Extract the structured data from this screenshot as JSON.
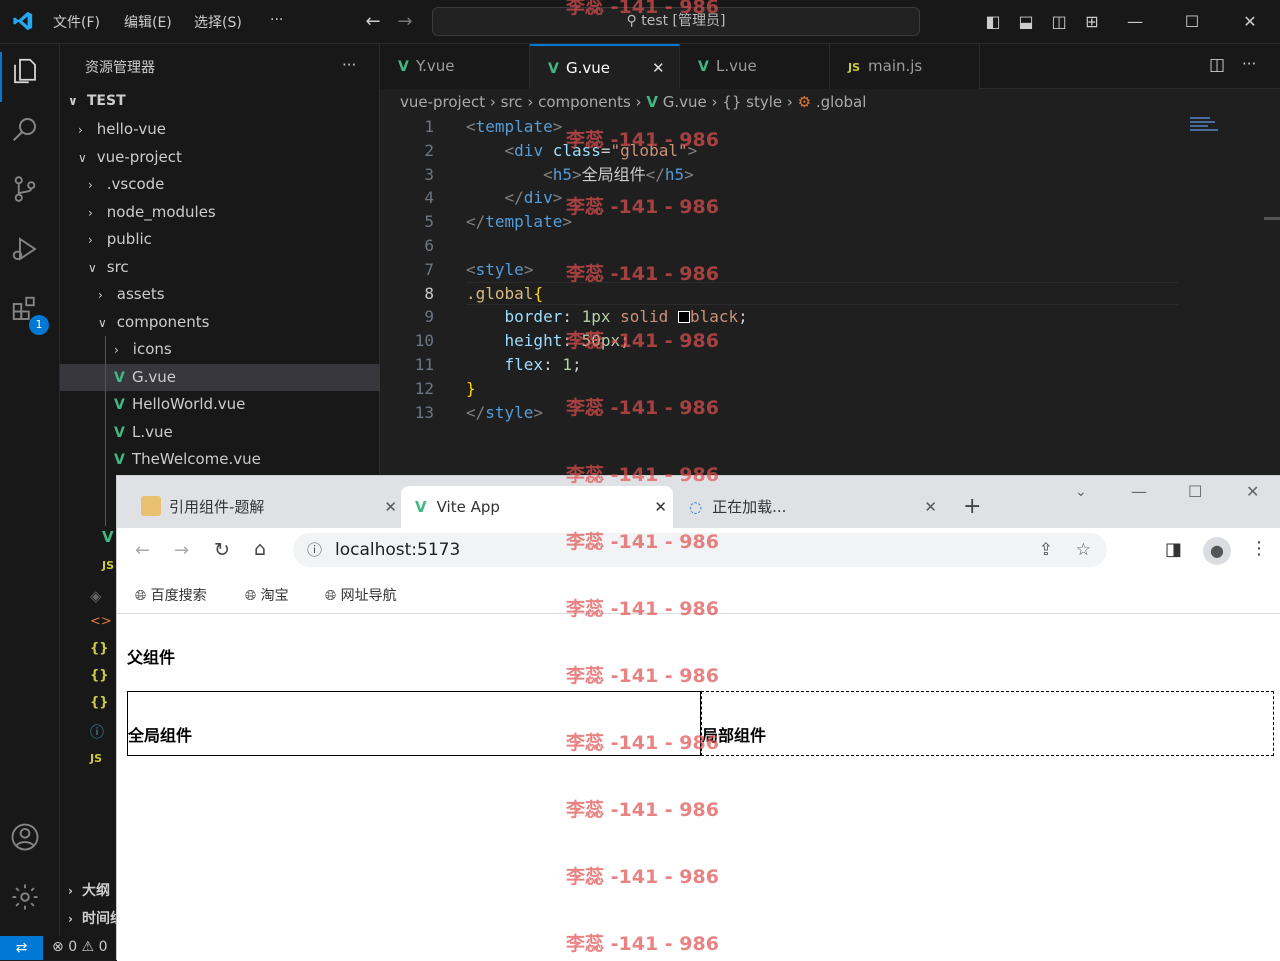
{
  "titlebar": {
    "menus": [
      "文件(F)",
      "编辑(E)",
      "选择(S)",
      "···"
    ],
    "command_center": "test [管理员]"
  },
  "activity_badge": "1",
  "sidebar": {
    "title": "资源管理器",
    "more": "···",
    "root": "TEST",
    "items": [
      {
        "label": "hello-vue",
        "depth": 1,
        "type": "folder-closed"
      },
      {
        "label": "vue-project",
        "depth": 1,
        "type": "folder-open"
      },
      {
        "label": ".vscode",
        "depth": 2,
        "type": "folder-closed"
      },
      {
        "label": "node_modules",
        "depth": 2,
        "type": "folder-closed"
      },
      {
        "label": "public",
        "depth": 2,
        "type": "folder-closed"
      },
      {
        "label": "src",
        "depth": 2,
        "type": "folder-open"
      },
      {
        "label": "assets",
        "depth": 3,
        "type": "folder-closed"
      },
      {
        "label": "components",
        "depth": 3,
        "type": "folder-open"
      },
      {
        "label": "icons",
        "depth": 4,
        "type": "folder-closed"
      },
      {
        "label": "G.vue",
        "depth": 4,
        "type": "vue",
        "selected": true
      },
      {
        "label": "HelloWorld.vue",
        "depth": 4,
        "type": "vue"
      },
      {
        "label": "L.vue",
        "depth": 4,
        "type": "vue"
      },
      {
        "label": "TheWelcome.vue",
        "depth": 4,
        "type": "vue"
      }
    ],
    "outline": "大纲",
    "timeline": "时间线"
  },
  "tabs": [
    {
      "label": "Y.vue",
      "type": "vue"
    },
    {
      "label": "G.vue",
      "type": "vue",
      "active": true
    },
    {
      "label": "L.vue",
      "type": "vue"
    },
    {
      "label": "main.js",
      "type": "js"
    }
  ],
  "breadcrumb": [
    "vue-project",
    "src",
    "components",
    "G.vue",
    "{} style",
    ".global"
  ],
  "editor": {
    "line_numbers": [
      "1",
      "2",
      "3",
      "4",
      "5",
      "6",
      "7",
      "8",
      "9",
      "10",
      "11",
      "12",
      "13"
    ],
    "current_line": "8"
  },
  "status": {
    "errors": "0",
    "warnings": "0"
  },
  "browser": {
    "tabs": [
      {
        "label": "引用组件-题解"
      },
      {
        "label": "Vite App",
        "active": true
      },
      {
        "label": "正在加载..."
      }
    ],
    "url": "localhost:5173",
    "bookmarks": [
      "百度搜索",
      "淘宝",
      "网址导航"
    ],
    "page": {
      "parent_heading": "父组件",
      "global_heading": "全局组件",
      "local_heading": "局部组件"
    }
  },
  "watermark": "李蕊 -141 - 986",
  "colors": {
    "accent": "#0078d4",
    "vue": "#41b883",
    "js": "#cbcb41"
  }
}
